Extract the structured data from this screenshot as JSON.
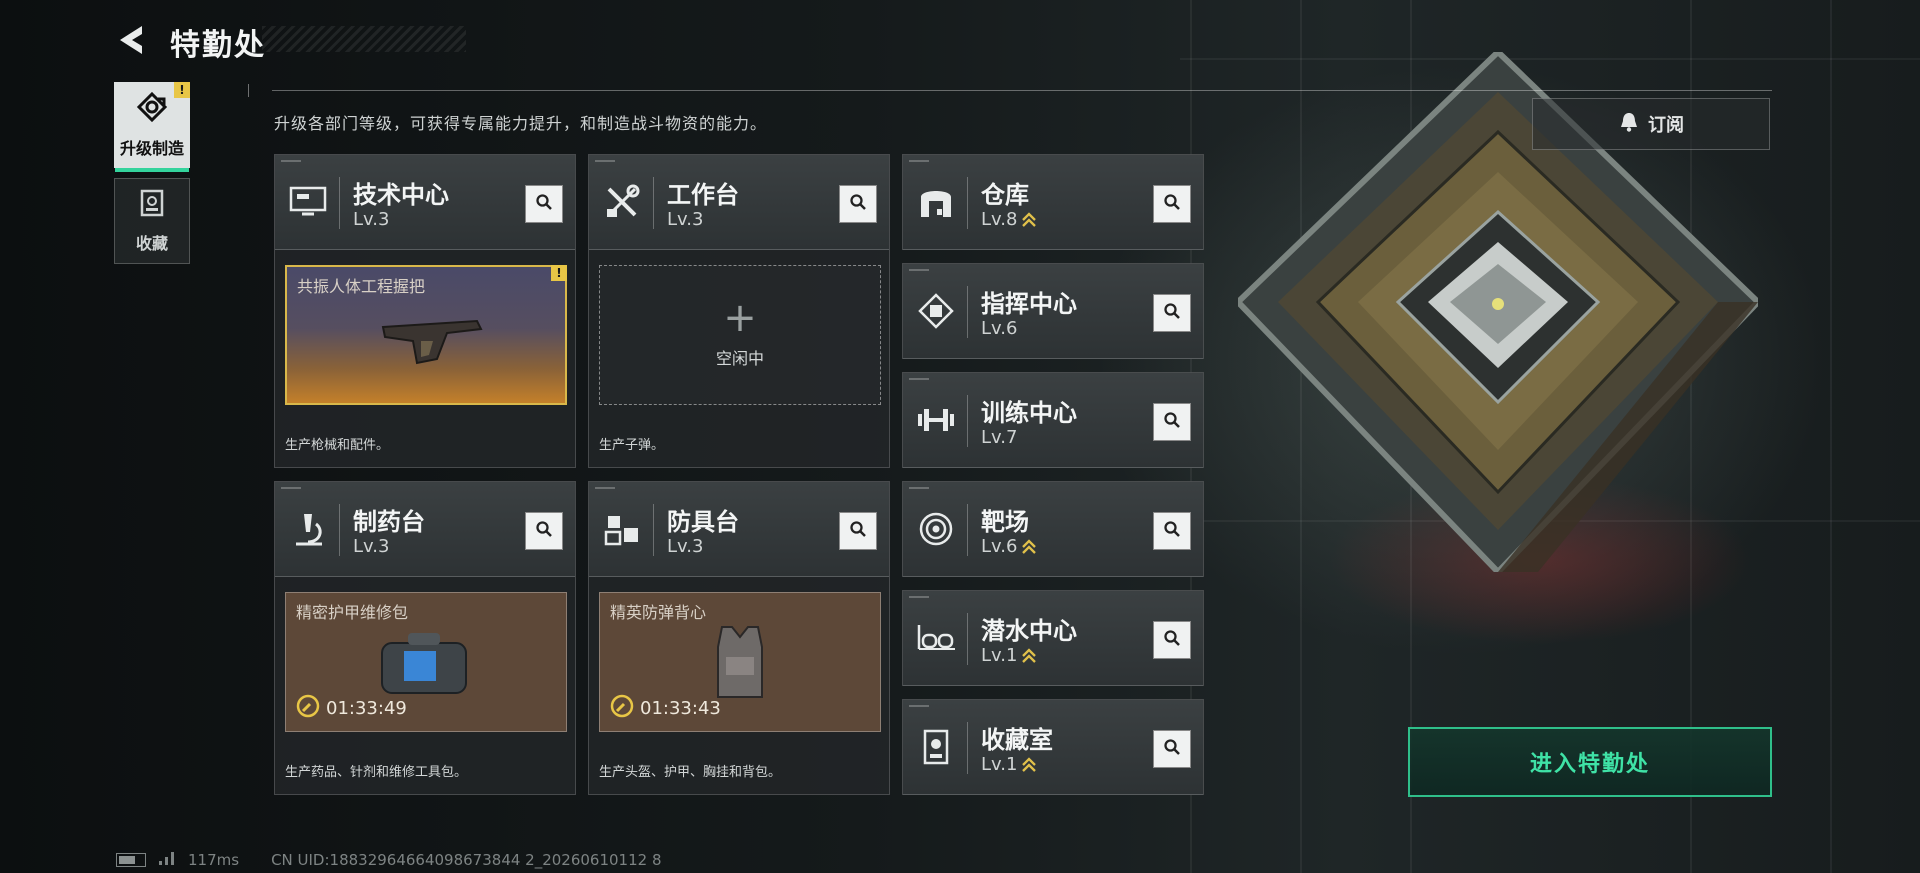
{
  "header": {
    "title": "特勤处"
  },
  "sidebar": {
    "items": [
      {
        "label": "升级制造",
        "active": true,
        "alert": "!"
      },
      {
        "label": "收藏",
        "active": false
      }
    ]
  },
  "description": "升级各部门等级，可获得专属能力提升，和制造战斗物资的能力。",
  "subscribe_label": "订阅",
  "enter_label": "进入特勤处",
  "production_cards": [
    {
      "name": "技术中心",
      "level": "Lv.3",
      "icon": "computer-icon",
      "slot": {
        "type": "item",
        "title": "共振人体工程握把",
        "alert": "!"
      },
      "footer": "生产枪械和配件。"
    },
    {
      "name": "工作台",
      "level": "Lv.3",
      "icon": "tools-icon",
      "slot": {
        "type": "empty",
        "plus": "+",
        "text": "空闲中"
      },
      "footer": "生产子弹。"
    },
    {
      "name": "制药台",
      "level": "Lv.3",
      "icon": "microscope-icon",
      "slot": {
        "type": "timer",
        "title": "精密护甲维修包",
        "timer": "01:33:49"
      },
      "footer": "生产药品、针剂和维修工具包。"
    },
    {
      "name": "防具台",
      "level": "Lv.3",
      "icon": "cubes-icon",
      "slot": {
        "type": "timer",
        "title": "精英防弹背心",
        "timer": "01:33:43"
      },
      "footer": "生产头盔、护甲、胸挂和背包。"
    }
  ],
  "facilities": [
    {
      "name": "仓库",
      "level": "Lv.8",
      "upgradable": true,
      "icon": "warehouse-icon"
    },
    {
      "name": "指挥中心",
      "level": "Lv.6",
      "upgradable": false,
      "icon": "chip-icon"
    },
    {
      "name": "训练中心",
      "level": "Lv.7",
      "upgradable": false,
      "icon": "dumbbell-icon"
    },
    {
      "name": "靶场",
      "level": "Lv.6",
      "upgradable": true,
      "icon": "target-icon"
    },
    {
      "name": "潜水中心",
      "level": "Lv.1",
      "upgradable": true,
      "icon": "diving-goggles-icon"
    },
    {
      "name": "收藏室",
      "level": "Lv.1",
      "upgradable": true,
      "icon": "display-case-icon"
    }
  ],
  "status": {
    "ping": "117ms",
    "uid": "CN UID:18832964664098673844 2_20260610112 8"
  },
  "colors": {
    "accent": "#3fe2a6",
    "alert": "#e8c646",
    "upgrade_chevron": "#e0c04a"
  }
}
